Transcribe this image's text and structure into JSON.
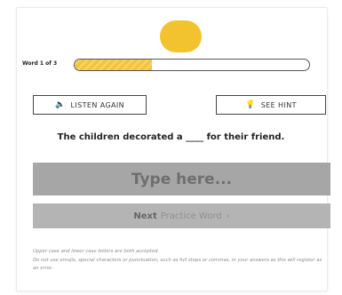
{
  "progress": {
    "label": "Word 1 of 3",
    "fraction": 0.33
  },
  "actions": {
    "listen_label": "LISTEN AGAIN",
    "hint_label": "SEE HINT"
  },
  "prompt": {
    "sentence": "The children decorated a ____ for their friend."
  },
  "answer": {
    "placeholder": "Type here...",
    "value": ""
  },
  "next": {
    "bold": "Next",
    "rest": "Practice Word"
  },
  "notes": {
    "line1": "Upper case and lower case letters are both accepted.",
    "line2": "Do not use emojis, special characters or punctuation, such as full stops or commas, in your answers as this will register as an error."
  },
  "icons": {
    "listen": "speaker-icon",
    "hint": "lightbulb-icon",
    "next": "chevron-right-icon"
  },
  "colors": {
    "accent": "#f2c32f",
    "answer_bg": "#a6a6a6",
    "next_bg": "#b4b4b4"
  }
}
